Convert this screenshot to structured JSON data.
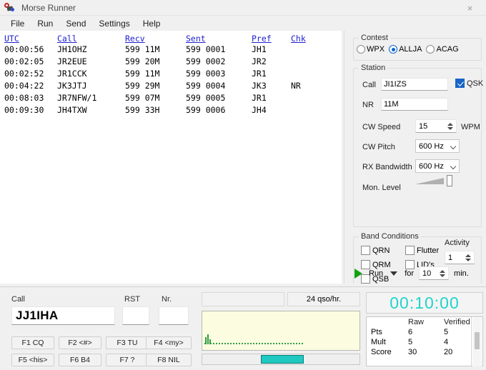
{
  "window": {
    "title": "Morse Runner",
    "close_label": "×",
    "icon": "morse-key-icon"
  },
  "menu": {
    "items": [
      "File",
      "Run",
      "Send",
      "Settings",
      "Help"
    ]
  },
  "log": {
    "headers": [
      "UTC",
      "Call",
      "Recv",
      "Sent",
      "Pref",
      "Chk"
    ],
    "rows": [
      {
        "utc": "00:00:56",
        "call": "JH1OHZ",
        "recv": "599 11M",
        "sent": "599 0001",
        "pref": "JH1",
        "chk": ""
      },
      {
        "utc": "00:02:05",
        "call": "JR2EUE",
        "recv": "599 20M",
        "sent": "599 0002",
        "pref": "JR2",
        "chk": ""
      },
      {
        "utc": "00:02:52",
        "call": "JR1CCK",
        "recv": "599 11M",
        "sent": "599 0003",
        "pref": "JR1",
        "chk": ""
      },
      {
        "utc": "00:04:22",
        "call": "JK3JTJ",
        "recv": "599 29M",
        "sent": "599 0004",
        "pref": "JK3",
        "chk": "NR"
      },
      {
        "utc": "00:08:03",
        "call": "JR7NFW/1",
        "recv": "599 07M",
        "sent": "599 0005",
        "pref": "JR1",
        "chk": ""
      },
      {
        "utc": "00:09:30",
        "call": "JH4TXW",
        "recv": "599 33H",
        "sent": "599 0006",
        "pref": "JH4",
        "chk": ""
      }
    ]
  },
  "contest": {
    "legend": "Contest",
    "options": [
      "WPX",
      "ALLJA",
      "ACAG"
    ],
    "selected": "ALLJA"
  },
  "station": {
    "legend": "Station",
    "call_label": "Call",
    "call_value": "JI1IZS",
    "qsk_label": "QSK",
    "qsk_checked": true,
    "nr_label": "NR",
    "nr_value": "11M",
    "cw_speed_label": "CW Speed",
    "cw_speed_value": "15",
    "cw_speed_unit": "WPM",
    "cw_pitch_label": "CW Pitch",
    "cw_pitch_value": "600 Hz",
    "rx_bandwidth_label": "RX Bandwidth",
    "rx_bandwidth_value": "600 Hz",
    "mon_level_label": "Mon. Level"
  },
  "band_conditions": {
    "legend": "Band Conditions",
    "qrn_label": "QRN",
    "qrm_label": "QRM",
    "qsb_label": "QSB",
    "flutter_label": "Flutter",
    "lids_label": "LID's",
    "activity_label": "Activity",
    "activity_value": "1"
  },
  "run_bar": {
    "run_label": "Run",
    "for_label": "for",
    "minutes_value": "10",
    "min_label": "min."
  },
  "entry": {
    "call_label": "Call",
    "call_value": "JJ1IHA",
    "rst_label": "RST",
    "rst_value": "",
    "nr_label": "Nr.",
    "nr_value": "",
    "function_keys": [
      "F1 CQ",
      "F2 <#>",
      "F3 TU",
      "F4 <my>",
      "F5 <his>",
      "F6 B4",
      "F7 ?",
      "F8 NIL"
    ]
  },
  "center": {
    "status_text": "",
    "rate_text": "24 qso/hr."
  },
  "score": {
    "clock": "00:10:00",
    "columns": [
      "",
      "Raw",
      "Verified"
    ],
    "rows": [
      {
        "label": "Pts",
        "raw": "6",
        "verified": "5"
      },
      {
        "label": "Mult",
        "raw": "5",
        "verified": "4"
      },
      {
        "label": "Score",
        "raw": "30",
        "verified": "20"
      }
    ]
  },
  "colors": {
    "accent_blue": "#1565c7",
    "radio_blue": "#0a64d2",
    "header_blue": "#2020d0",
    "clock_cyan": "#1fd4cc",
    "slider_cyan": "#1fc8c0",
    "waterfall_bg": "#fcfce0",
    "trace_green": "#2f9e44",
    "play_green": "#11a011"
  }
}
